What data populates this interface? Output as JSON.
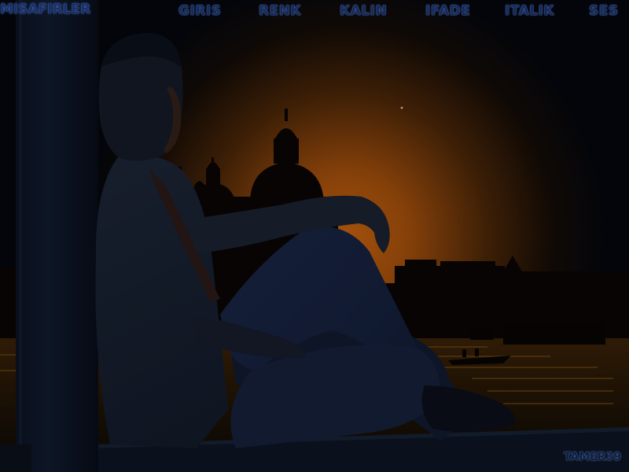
{
  "header": {
    "site_label": "MISAFIRLER"
  },
  "menu": {
    "items": [
      {
        "label": "GIRIS"
      },
      {
        "label": "RENK"
      },
      {
        "label": "KALIN"
      },
      {
        "label": "IFADE"
      },
      {
        "label": "ITALIK"
      },
      {
        "label": "SES"
      }
    ]
  },
  "footer": {
    "signature": "TAMER39"
  },
  "colors": {
    "menu_text": "#152a5c",
    "menu_glow": "#6d8fd0",
    "sky_glow": "#b3540c",
    "background": "#05070d"
  }
}
